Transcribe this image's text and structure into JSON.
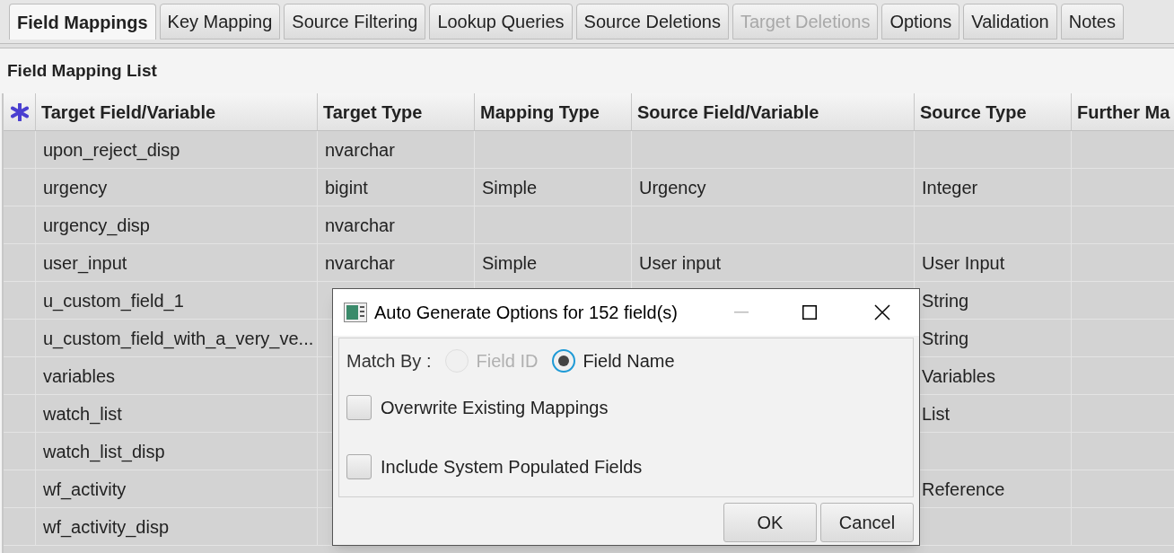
{
  "tabs": [
    {
      "label": "Field Mappings",
      "selected": true,
      "disabled": false
    },
    {
      "label": "Key Mapping",
      "selected": false,
      "disabled": false
    },
    {
      "label": "Source Filtering",
      "selected": false,
      "disabled": false
    },
    {
      "label": "Lookup Queries",
      "selected": false,
      "disabled": false
    },
    {
      "label": "Source Deletions",
      "selected": false,
      "disabled": false
    },
    {
      "label": "Target Deletions",
      "selected": false,
      "disabled": true
    },
    {
      "label": "Options",
      "selected": false,
      "disabled": false
    },
    {
      "label": "Validation",
      "selected": false,
      "disabled": false
    },
    {
      "label": "Notes",
      "selected": false,
      "disabled": false
    }
  ],
  "panel_title": "Field Mapping List",
  "table": {
    "columns": [
      "Target Field/Variable",
      "Target Type",
      "Mapping Type",
      "Source Field/Variable",
      "Source Type",
      "Further Ma"
    ],
    "rows": [
      {
        "target_field": "upon_reject_disp",
        "target_type": "nvarchar"
      },
      {
        "target_field": "urgency",
        "target_type": "bigint",
        "mapping_type": "Simple",
        "source_field": "Urgency",
        "source_type": "Integer"
      },
      {
        "target_field": "urgency_disp",
        "target_type": "nvarchar"
      },
      {
        "target_field": "user_input",
        "target_type": "nvarchar",
        "mapping_type": "Simple",
        "source_field": "User input",
        "source_type": "User Input"
      },
      {
        "target_field": "u_custom_field_1",
        "source_type": "String"
      },
      {
        "target_field": "u_custom_field_with_a_very_ve...",
        "source_type": "String"
      },
      {
        "target_field": "variables",
        "source_type": "Variables"
      },
      {
        "target_field": "watch_list",
        "source_type": "List"
      },
      {
        "target_field": "watch_list_disp"
      },
      {
        "target_field": "wf_activity",
        "source_type": "Reference"
      },
      {
        "target_field": "wf_activity_disp"
      }
    ]
  },
  "dialog": {
    "title": "Auto Generate Options for 152 field(s)",
    "match_by_label": "Match By :",
    "radios": [
      {
        "label": "Field ID",
        "selected": false,
        "disabled": true
      },
      {
        "label": "Field Name",
        "selected": true,
        "disabled": false
      }
    ],
    "checkboxes": [
      {
        "label": "Overwrite Existing Mappings",
        "checked": false
      },
      {
        "label": "Include System Populated Fields",
        "checked": false
      }
    ],
    "buttons": [
      "OK",
      "Cancel"
    ]
  }
}
